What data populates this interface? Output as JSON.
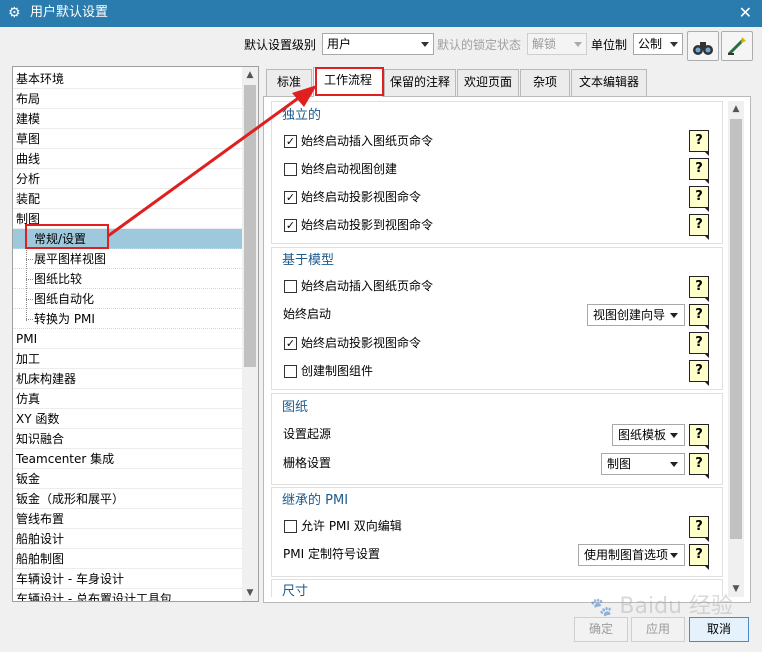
{
  "window": {
    "title": "用户默认设置"
  },
  "topbar": {
    "level_label": "默认设置级别",
    "level_value": "用户",
    "lock_label": "默认的锁定状态",
    "lock_value": "解锁",
    "unit_label": "单位制",
    "unit_value": "公制"
  },
  "tree": {
    "items": [
      "基本环境",
      "布局",
      "建模",
      "草图",
      "曲线",
      "分析",
      "装配",
      "制图",
      "常规/设置",
      "展平图样视图",
      "图纸比较",
      "图纸自动化",
      "转换为 PMI",
      "PMI",
      "加工",
      "机床构建器",
      "仿真",
      "XY 函数",
      "知识融合",
      "Teamcenter 集成",
      "钣金",
      "钣金（成形和展平）",
      "管线布置",
      "船舶设计",
      "船舶制图",
      "车辆设计 - 车身设计",
      "车辆设计 - 总布置设计工具包"
    ],
    "selected": "常规/设置"
  },
  "tabs": [
    "标准",
    "工作流程",
    "保留的注释",
    "欢迎页面",
    "杂项",
    "文本编辑器"
  ],
  "active_tab": "工作流程",
  "groups": {
    "independent": {
      "title": "独立的",
      "rows": [
        {
          "label": "始终启动插入图纸页命令",
          "checked": true
        },
        {
          "label": "始终启动视图创建",
          "checked": false
        },
        {
          "label": "始终启动投影视图命令",
          "checked": true
        },
        {
          "label": "始终启动投影到视图命令",
          "checked": true
        }
      ]
    },
    "model_based": {
      "title": "基于模型",
      "row1_label": "始终启动插入图纸页命令",
      "row1_checked": false,
      "row2_label": "始终启动",
      "row2_value": "视图创建向导",
      "row3_label": "始终启动投影视图命令",
      "row3_checked": true,
      "row4_label": "创建制图组件",
      "row4_checked": false
    },
    "drawing": {
      "title": "图纸",
      "row1_label": "设置起源",
      "row1_value": "图纸模板",
      "row2_label": "栅格设置",
      "row2_value": "制图"
    },
    "pmi": {
      "title": "继承的 PMI",
      "row1_label": "允许 PMI 双向编辑",
      "row1_checked": false,
      "row2_label": "PMI 定制符号设置",
      "row2_value": "使用制图首选项"
    },
    "dimension": {
      "title": "尺寸"
    }
  },
  "help_glyph": "?",
  "buttons": {
    "ok": "确定",
    "apply": "应用",
    "cancel": "取消"
  },
  "watermark": "Baidu 经验",
  "icons": [
    "gear-icon",
    "close-icon",
    "binoculars-icon",
    "wand-icon",
    "help-icon",
    "chevron-down-icon"
  ],
  "colors": {
    "titlebar": "#2b7cae",
    "selection": "#9ec9dd",
    "group_title": "#1e5a8c",
    "highlight": "#e02020"
  }
}
